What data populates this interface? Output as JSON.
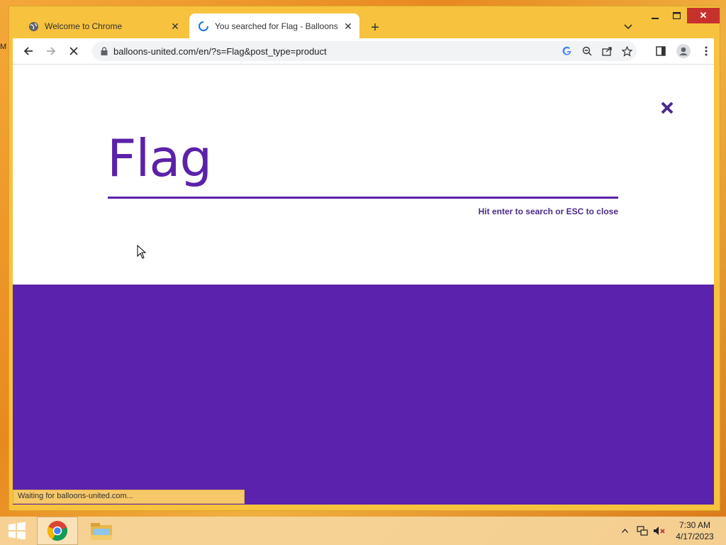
{
  "desktop": {
    "edge_text": "M"
  },
  "tabs": [
    {
      "title": "Welcome to Chrome",
      "icon": "globe-icon",
      "active": false
    },
    {
      "title": "You searched for Flag - Balloons",
      "icon": "loading-spinner-icon",
      "active": true
    }
  ],
  "window_controls": {
    "minimize": "minimize-icon",
    "maximize": "maximize-icon",
    "close": "close-icon"
  },
  "toolbar": {
    "url": "balloons-united.com/en/?s=Flag&post_type=product",
    "icons": [
      "back-icon",
      "forward-icon",
      "stop-icon",
      "lock-icon",
      "google-icon",
      "zoom-icon",
      "share-icon",
      "bookmark-star-icon",
      "side-panel-icon",
      "profile-icon",
      "menu-icon"
    ]
  },
  "page": {
    "search_term": "Flag",
    "hint": "Hit enter to search or ESC to close"
  },
  "status_bar": {
    "text": "Waiting for balloons-united.com..."
  },
  "taskbar": {
    "time": "7:30 AM",
    "date": "4/17/2023"
  },
  "colors": {
    "accent_purple": "#5b22ad",
    "window_frame": "#f7c23d",
    "taskbar": "#f6d69c"
  }
}
